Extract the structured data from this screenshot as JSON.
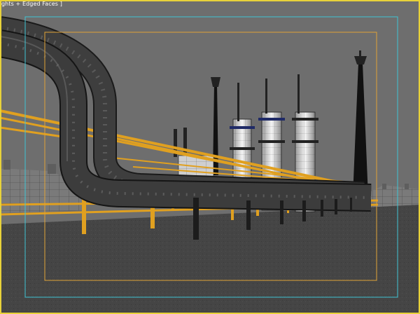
{
  "viewport": {
    "label": "ghts + Edged Faces ]",
    "active_border_color": "#e8d23a",
    "safe_frame_outer_color": "#3fc4d4",
    "safe_frame_inner_color": "#e0a236",
    "background_color": "#6e6e6e",
    "ground_color": "#404040",
    "pipe_color": "#3a3a3a",
    "rack_color": "#e0a020",
    "tower_color": "#e6e6e6"
  }
}
